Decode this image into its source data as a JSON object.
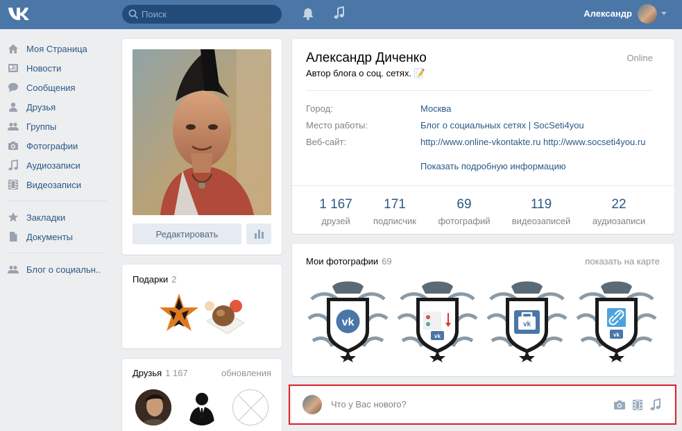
{
  "header": {
    "search_placeholder": "Поиск",
    "user_name": "Александр",
    "brand_color": "#4a76a8"
  },
  "sidebar": {
    "items": [
      {
        "label": "Моя Страница",
        "icon": "home-icon"
      },
      {
        "label": "Новости",
        "icon": "news-icon"
      },
      {
        "label": "Сообщения",
        "icon": "messages-icon"
      },
      {
        "label": "Друзья",
        "icon": "friend-icon"
      },
      {
        "label": "Группы",
        "icon": "groups-icon"
      },
      {
        "label": "Фотографии",
        "icon": "camera-icon"
      },
      {
        "label": "Аудиозаписи",
        "icon": "music-icon"
      },
      {
        "label": "Видеозаписи",
        "icon": "video-icon"
      },
      {
        "label": "Закладки",
        "icon": "star-icon"
      },
      {
        "label": "Документы",
        "icon": "document-icon"
      },
      {
        "label": "Блог о социальн..",
        "icon": "group-icon"
      }
    ]
  },
  "profile": {
    "name": "Александр Диченко",
    "status": "Автор блога о соц. сетях. 📝",
    "online": "Online",
    "edit_label": "Редактировать",
    "info": [
      {
        "label": "Город:",
        "value": "Москва"
      },
      {
        "label": "Место работы:",
        "value": "Блог о социальных сетях | SocSeti4you"
      },
      {
        "label": "Веб-сайт:",
        "value": "http://www.online-vkontakte.ru http://www.socseti4you.ru"
      }
    ],
    "more_info": "Показать подробную информацию",
    "counters": [
      {
        "num": "1 167",
        "cap": "друзей"
      },
      {
        "num": "171",
        "cap": "подписчик"
      },
      {
        "num": "69",
        "cap": "фотографий"
      },
      {
        "num": "119",
        "cap": "видеозаписей"
      },
      {
        "num": "22",
        "cap": "аудиозаписи"
      }
    ]
  },
  "gifts": {
    "title": "Подарки",
    "count": "2"
  },
  "friends": {
    "title": "Друзья",
    "count": "1 167",
    "updates": "обновления"
  },
  "photos": {
    "title": "Мои фотографии",
    "count": "69",
    "map_link": "показать на карте"
  },
  "post": {
    "placeholder": "Что у Вас нового?"
  }
}
